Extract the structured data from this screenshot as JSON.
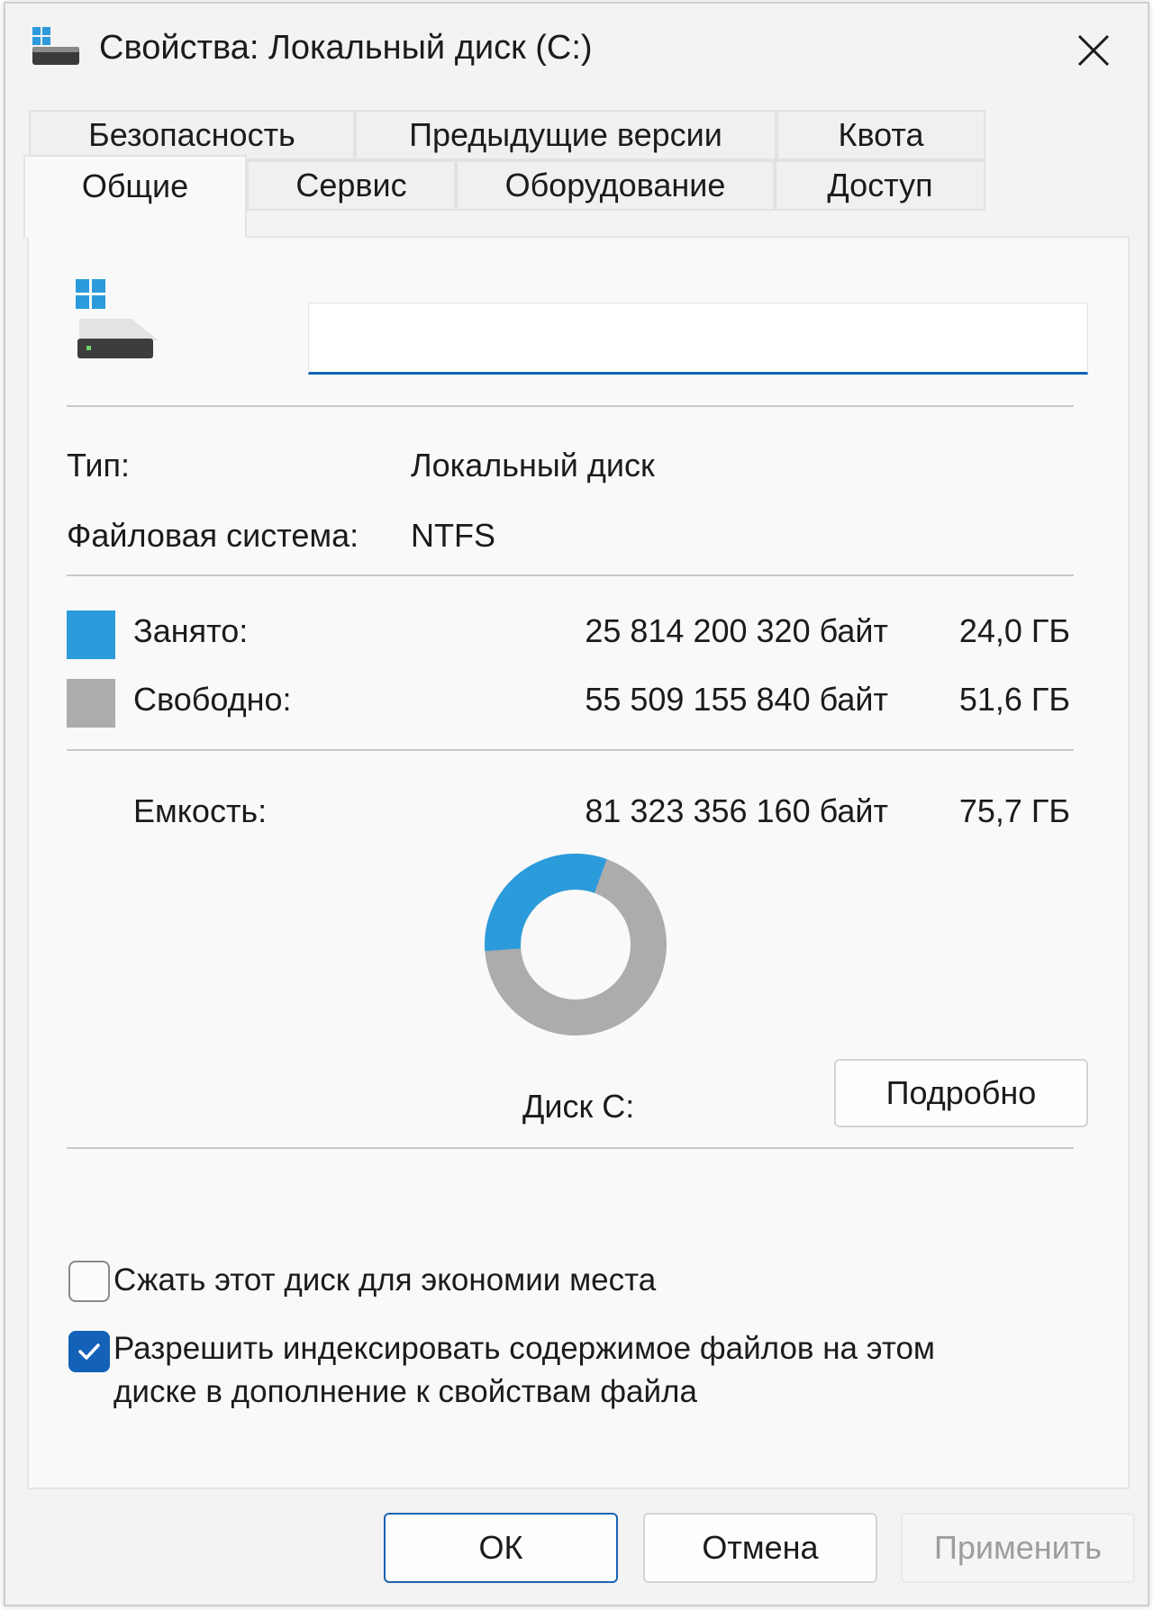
{
  "window": {
    "title": "Свойства: Локальный диск (C:)",
    "icon": "drive-icon",
    "close_icon": "close-icon"
  },
  "tabs": {
    "row_top": [
      "Безопасность",
      "Предыдущие версии",
      "Квота"
    ],
    "row_bottom": [
      "Общие",
      "Сервис",
      "Оборудование",
      "Доступ"
    ],
    "active": "Общие"
  },
  "general": {
    "name_value": "",
    "type_label": "Тип:",
    "type_value": "Локальный диск",
    "fs_label": "Файловая система:",
    "fs_value": "NTFS",
    "used": {
      "label": "Занято:",
      "bytes": "25 814 200 320 байт",
      "size": "24,0 ГБ",
      "color": "#2b9bdc"
    },
    "free": {
      "label": "Свободно:",
      "bytes": "55 509 155 840 байт",
      "size": "51,6 ГБ",
      "color": "#acacac"
    },
    "capacity": {
      "label": "Емкость:",
      "bytes": "81 323 356 160 байт",
      "size": "75,7 ГБ"
    },
    "used_fraction": 0.317,
    "disk_label": "Диск C:",
    "details_button": "Подробно",
    "compress": {
      "label": "Сжать этот диск для экономии места",
      "checked": false
    },
    "index": {
      "line1": "Разрешить индексировать содержимое файлов на этом",
      "line2": "диске в дополнение к свойствам файла",
      "checked": true
    }
  },
  "footer": {
    "ok": "ОК",
    "cancel": "Отмена",
    "apply": "Применить"
  }
}
